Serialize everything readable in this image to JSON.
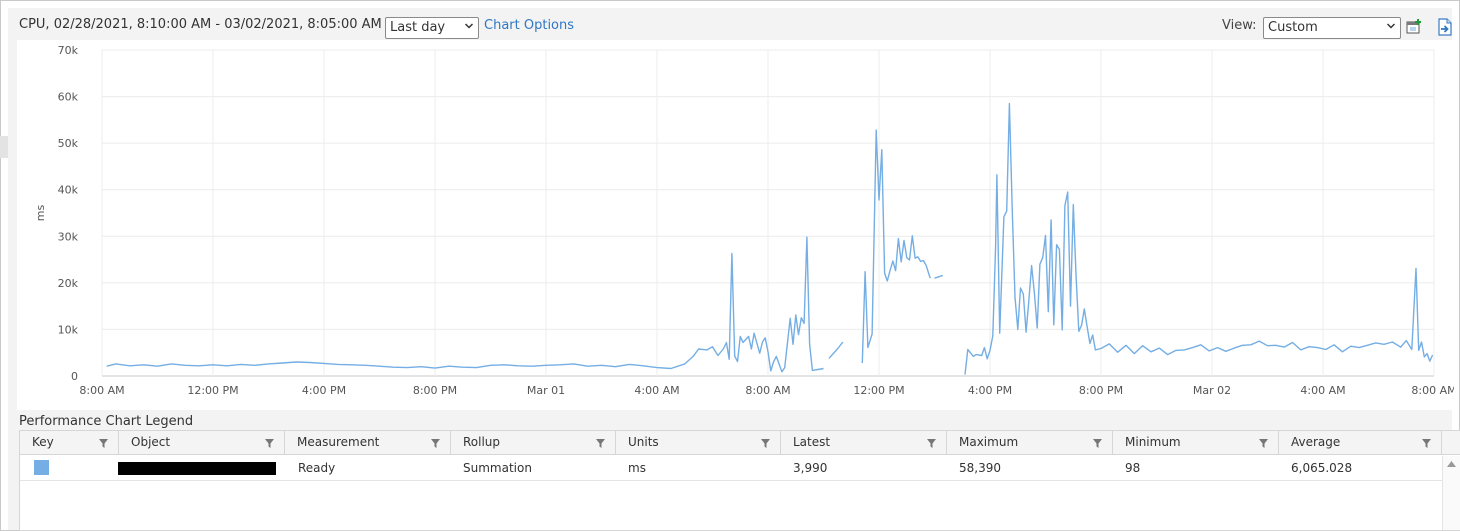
{
  "toolbar": {
    "title": "CPU, 02/28/2021, 8:10:00 AM - 03/02/2021, 8:05:00 AM",
    "period_value": "Last day",
    "chart_options_label": "Chart Options",
    "view_label": "View:",
    "view_value": "Custom"
  },
  "icons": {
    "new_chart": "new-chart-icon",
    "export": "export-icon",
    "dropdown": "chevron-down-icon",
    "filter": "filter-icon",
    "scroll_up": "scroll-up-icon"
  },
  "colors": {
    "series": "#74aee4",
    "link": "#2f78c4",
    "grid": "#ececec"
  },
  "legend": {
    "title": "Performance Chart Legend",
    "columns": [
      "Key",
      "Object",
      "Measurement",
      "Rollup",
      "Units",
      "Latest",
      "Maximum",
      "Minimum",
      "Average"
    ],
    "rows": [
      {
        "measurement": "Ready",
        "rollup": "Summation",
        "units": "ms",
        "latest": "3,990",
        "maximum": "58,390",
        "minimum": "98",
        "average": "6,065.028"
      }
    ]
  },
  "chart_data": {
    "type": "line",
    "title": "",
    "xlabel": "",
    "ylabel": "ms",
    "ylim": [
      0,
      70000
    ],
    "y_ticks": [
      "0",
      "10k",
      "20k",
      "30k",
      "40k",
      "50k",
      "60k",
      "70k"
    ],
    "x_ticks": [
      "8:00 AM",
      "12:00 PM",
      "4:00 PM",
      "8:00 PM",
      "Mar 01",
      "4:00 AM",
      "8:00 AM",
      "12:00 PM",
      "4:00 PM",
      "8:00 PM",
      "Mar 02",
      "4:00 AM",
      "8:00 AM"
    ],
    "x_unit": "hours from 02/28/2021 8:00 AM",
    "xlim": [
      0,
      48
    ],
    "grid": true,
    "series": [
      {
        "color": "#74aee4",
        "segments": [
          [
            [
              0.17,
              2100
            ],
            [
              0.5,
              2600
            ],
            [
              1,
              2200
            ],
            [
              1.5,
              2400
            ],
            [
              2,
              2100
            ],
            [
              2.5,
              2600
            ],
            [
              3,
              2300
            ],
            [
              3.5,
              2200
            ],
            [
              4,
              2400
            ],
            [
              4.5,
              2200
            ],
            [
              5,
              2500
            ],
            [
              5.5,
              2300
            ],
            [
              6,
              2600
            ],
            [
              6.5,
              2800
            ],
            [
              7,
              3000
            ],
            [
              7.5,
              2900
            ],
            [
              8,
              2700
            ],
            [
              8.5,
              2500
            ],
            [
              9,
              2400
            ],
            [
              9.5,
              2300
            ],
            [
              10,
              2100
            ],
            [
              10.5,
              1900
            ],
            [
              11,
              1800
            ],
            [
              11.5,
              2000
            ],
            [
              12,
              1700
            ],
            [
              12.5,
              2100
            ],
            [
              13,
              1900
            ],
            [
              13.5,
              1800
            ],
            [
              14,
              2300
            ],
            [
              14.5,
              2400
            ],
            [
              15,
              2200
            ],
            [
              15.5,
              2100
            ],
            [
              16,
              2300
            ],
            [
              16.5,
              2400
            ],
            [
              17,
              2600
            ],
            [
              17.5,
              2100
            ],
            [
              18,
              2300
            ],
            [
              18.5,
              2000
            ],
            [
              19,
              2500
            ],
            [
              19.5,
              2200
            ],
            [
              20,
              1800
            ],
            [
              20.5,
              1600
            ],
            [
              21,
              2600
            ],
            [
              21.3,
              4200
            ],
            [
              21.5,
              5800
            ],
            [
              21.8,
              5600
            ],
            [
              22,
              6300
            ],
            [
              22.2,
              4400
            ],
            [
              22.4,
              5900
            ],
            [
              22.5,
              7200
            ],
            [
              22.6,
              3600
            ],
            [
              22.7,
              26300
            ],
            [
              22.8,
              4300
            ],
            [
              22.9,
              3100
            ],
            [
              23,
              8500
            ],
            [
              23.1,
              7200
            ],
            [
              23.3,
              8500
            ],
            [
              23.4,
              5800
            ],
            [
              23.5,
              9200
            ],
            [
              23.7,
              4900
            ],
            [
              23.8,
              7300
            ],
            [
              23.9,
              8200
            ],
            [
              24,
              5200
            ],
            [
              24.1,
              1100
            ],
            [
              24.2,
              3000
            ],
            [
              24.3,
              4200
            ],
            [
              24.5,
              900
            ],
            [
              24.6,
              1800
            ],
            [
              24.8,
              12400
            ],
            [
              24.9,
              6800
            ],
            [
              25,
              13100
            ],
            [
              25.1,
              8900
            ],
            [
              25.2,
              12500
            ],
            [
              25.3,
              11300
            ],
            [
              25.4,
              29800
            ],
            [
              25.5,
              6900
            ],
            [
              25.6,
              1200
            ],
            [
              25.7,
              1300
            ],
            [
              25.8,
              1400
            ],
            [
              25.9,
              1500
            ],
            [
              26,
              1600
            ]
          ],
          [
            [
              26.2,
              3800
            ],
            [
              26.5,
              5800
            ],
            [
              26.7,
              7300
            ]
          ],
          [
            [
              27.4,
              2800
            ],
            [
              27.5,
              22400
            ],
            [
              27.6,
              6100
            ],
            [
              27.75,
              9000
            ],
            [
              27.9,
              52800
            ],
            [
              28,
              37800
            ],
            [
              28.1,
              48600
            ],
            [
              28.2,
              22100
            ],
            [
              28.3,
              20400
            ],
            [
              28.4,
              22700
            ],
            [
              28.5,
              24700
            ],
            [
              28.6,
              22600
            ],
            [
              28.7,
              29500
            ],
            [
              28.8,
              24500
            ],
            [
              28.9,
              29100
            ],
            [
              29,
              25400
            ],
            [
              29.1,
              24900
            ],
            [
              29.2,
              30100
            ],
            [
              29.3,
              25300
            ],
            [
              29.4,
              25600
            ],
            [
              29.5,
              24600
            ],
            [
              29.6,
              24800
            ],
            [
              29.7,
              23700
            ],
            [
              29.8,
              21800
            ],
            [
              29.85,
              21000
            ]
          ],
          [
            [
              30,
              21000
            ],
            [
              30.3,
              21600
            ]
          ],
          [
            [
              31.1,
              300
            ],
            [
              31.2,
              5700
            ],
            [
              31.4,
              4200
            ],
            [
              31.5,
              4600
            ],
            [
              31.7,
              4400
            ],
            [
              31.8,
              6100
            ],
            [
              31.9,
              3700
            ],
            [
              32,
              5500
            ],
            [
              32.1,
              8600
            ],
            [
              32.2,
              27800
            ],
            [
              32.25,
              43200
            ],
            [
              32.35,
              9200
            ],
            [
              32.5,
              34200
            ],
            [
              32.6,
              35400
            ],
            [
              32.7,
              58500
            ],
            [
              32.8,
              36000
            ],
            [
              32.9,
              16900
            ],
            [
              33,
              10000
            ],
            [
              33.1,
              18900
            ],
            [
              33.2,
              17600
            ],
            [
              33.3,
              9400
            ],
            [
              33.4,
              16100
            ],
            [
              33.5,
              23700
            ],
            [
              33.6,
              17800
            ],
            [
              33.7,
              10300
            ],
            [
              33.8,
              24000
            ],
            [
              33.9,
              25400
            ],
            [
              34,
              30200
            ],
            [
              34.1,
              13800
            ],
            [
              34.2,
              33500
            ],
            [
              34.3,
              11000
            ],
            [
              34.4,
              28200
            ],
            [
              34.5,
              27200
            ],
            [
              34.6,
              9900
            ],
            [
              34.7,
              36600
            ],
            [
              34.8,
              39500
            ],
            [
              34.9,
              15000
            ],
            [
              35,
              36800
            ],
            [
              35.1,
              21800
            ],
            [
              35.2,
              9600
            ],
            [
              35.3,
              10900
            ],
            [
              35.4,
              14400
            ],
            [
              35.5,
              10600
            ],
            [
              35.6,
              7000
            ],
            [
              35.7,
              8800
            ],
            [
              35.8,
              5600
            ],
            [
              36,
              5900
            ],
            [
              36.3,
              6900
            ],
            [
              36.6,
              5100
            ],
            [
              36.9,
              6600
            ],
            [
              37.2,
              4800
            ],
            [
              37.5,
              6500
            ],
            [
              37.8,
              5200
            ],
            [
              38.1,
              6000
            ],
            [
              38.4,
              4600
            ],
            [
              38.7,
              5500
            ],
            [
              39,
              5600
            ],
            [
              39.3,
              6100
            ],
            [
              39.6,
              6700
            ],
            [
              39.9,
              5400
            ],
            [
              40.2,
              6100
            ],
            [
              40.5,
              5300
            ],
            [
              40.8,
              6000
            ],
            [
              41.1,
              6600
            ],
            [
              41.4,
              6700
            ],
            [
              41.7,
              7500
            ],
            [
              42,
              6500
            ],
            [
              42.3,
              6600
            ],
            [
              42.6,
              6200
            ],
            [
              42.9,
              7200
            ],
            [
              43.2,
              5600
            ],
            [
              43.5,
              6300
            ],
            [
              43.8,
              6100
            ],
            [
              44.1,
              5700
            ],
            [
              44.4,
              6700
            ],
            [
              44.7,
              5200
            ],
            [
              45,
              6400
            ],
            [
              45.3,
              6100
            ],
            [
              45.6,
              6600
            ],
            [
              45.9,
              7100
            ],
            [
              46.2,
              6800
            ],
            [
              46.5,
              7300
            ],
            [
              46.8,
              6200
            ],
            [
              47,
              7600
            ],
            [
              47.2,
              5700
            ],
            [
              47.35,
              23100
            ],
            [
              47.45,
              5500
            ],
            [
              47.55,
              7300
            ],
            [
              47.65,
              4100
            ],
            [
              47.75,
              4800
            ],
            [
              47.85,
              3200
            ],
            [
              47.95,
              4500
            ]
          ]
        ]
      }
    ]
  }
}
